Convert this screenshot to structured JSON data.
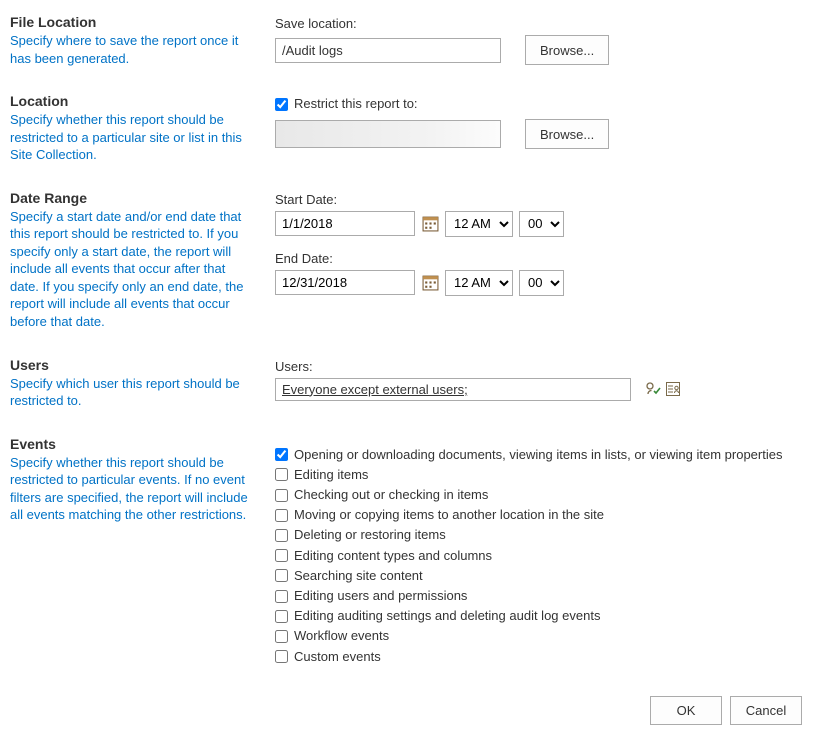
{
  "fileLocation": {
    "title": "File Location",
    "desc": "Specify where to save the report once it has been generated.",
    "saveLabel": "Save location:",
    "saveValue": "/Audit logs",
    "browse": "Browse..."
  },
  "location": {
    "title": "Location",
    "desc": "Specify whether this report should be restricted to a particular site or list in this Site Collection.",
    "restrictLabel": "Restrict this report to:",
    "browse": "Browse..."
  },
  "dateRange": {
    "title": "Date Range",
    "desc": "Specify a start date and/or end date that this report should be restricted to. If you specify only a start date, the report will include all events that occur after that date. If you specify only an end date, the report will include all events that occur before that date.",
    "startLabel": "Start Date:",
    "startValue": "1/1/2018",
    "endLabel": "End Date:",
    "endValue": "12/31/2018",
    "hourValue": "12 AM",
    "minuteValue": "00"
  },
  "users": {
    "title": "Users",
    "desc": "Specify which user this report should be restricted to.",
    "label": "Users:",
    "value": "Everyone except external users;"
  },
  "events": {
    "title": "Events",
    "desc": "Specify whether this report should be restricted to particular events. If no event filters are specified, the report will include all events matching the other restrictions.",
    "items": [
      "Opening or downloading documents, viewing items in lists, or viewing item properties",
      "Editing items",
      "Checking out or checking in items",
      "Moving or copying items to another location in the site",
      "Deleting or restoring items",
      "Editing content types and columns",
      "Searching site content",
      "Editing users and permissions",
      "Editing auditing settings and deleting audit log events",
      "Workflow events",
      "Custom events"
    ]
  },
  "footer": {
    "ok": "OK",
    "cancel": "Cancel"
  }
}
